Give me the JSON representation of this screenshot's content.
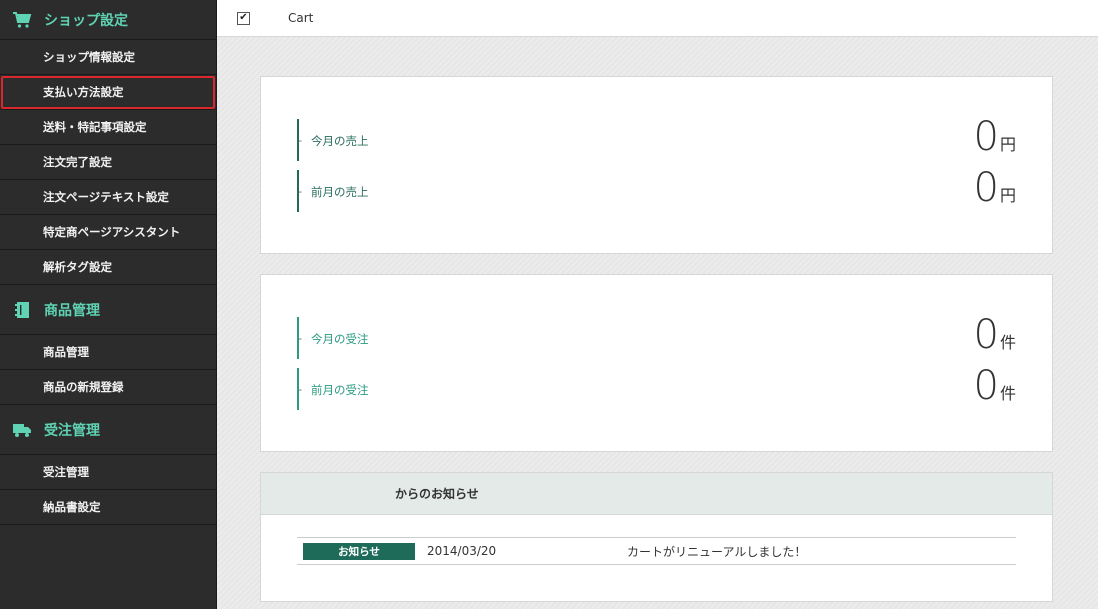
{
  "sidebar": {
    "sections": [
      {
        "title": "ショップ設定",
        "icon": "cart-icon",
        "items": [
          "ショップ情報設定",
          "支払い方法設定",
          "送料・特記事項設定",
          "注文完了設定",
          "注文ページテキスト設定",
          "特定商ページアシスタント",
          "解析タグ設定"
        ]
      },
      {
        "title": "商品管理",
        "icon": "notebook-icon",
        "items": [
          "商品管理",
          "商品の新規登録"
        ]
      },
      {
        "title": "受注管理",
        "icon": "truck-icon",
        "items": [
          "受注管理",
          "納品書設定"
        ]
      }
    ],
    "active_item": "支払い方法設定"
  },
  "topbar": {
    "checkbox_checked": true,
    "brand": "Cart"
  },
  "sales": {
    "today_label": "今月の売上",
    "today_value": "0",
    "prev_label": "前月の売上",
    "prev_value": "0",
    "unit": "円"
  },
  "orders": {
    "today_label": "今月の受注",
    "today_value": "0",
    "prev_label": "前月の受注",
    "prev_value": "0",
    "unit": "件"
  },
  "news": {
    "heading": "からのお知らせ",
    "items": [
      {
        "badge": "お知らせ",
        "date": "2014/03/20",
        "text": "カートがリニューアルしました！"
      }
    ]
  },
  "colors": {
    "sidebar_bg": "#2c2c2c",
    "accent": "#1e6b5a",
    "section_title": "#5fd3b3",
    "active_outline": "#d9272e"
  }
}
